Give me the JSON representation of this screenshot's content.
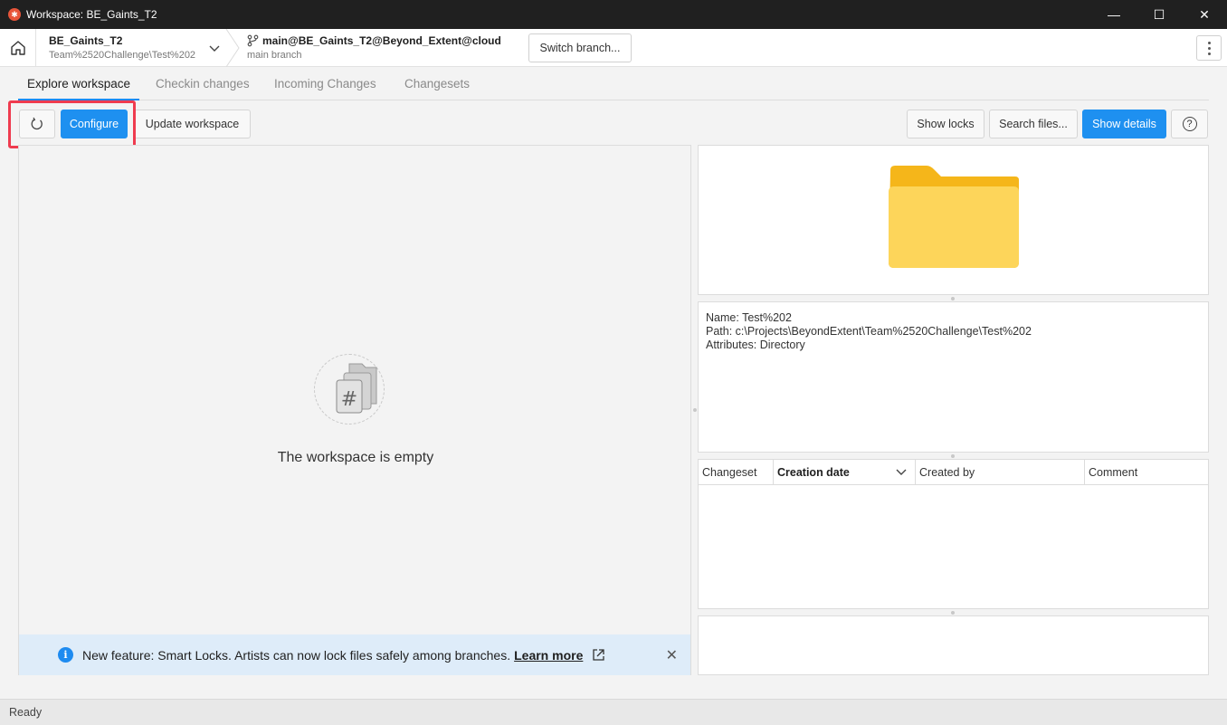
{
  "window": {
    "title": "Workspace: BE_Gaints_T2",
    "minimize_glyph": "—",
    "maximize_glyph": "☐",
    "close_glyph": "✕"
  },
  "header": {
    "workspace_name": "BE_Gaints_T2",
    "workspace_path": "Team%2520Challenge\\Test%202",
    "branch_name": "main@BE_Gaints_T2@Beyond_Extent@cloud",
    "branch_sub": "main branch",
    "switch_branch_label": "Switch branch..."
  },
  "tabs": [
    {
      "label": "Explore workspace",
      "active": true
    },
    {
      "label": "Checkin changes",
      "active": false
    },
    {
      "label": "Incoming Changes",
      "active": false
    },
    {
      "label": "Changesets",
      "active": false
    }
  ],
  "toolbar": {
    "configure_label": "Configure",
    "update_label": "Update workspace",
    "show_locks_label": "Show locks",
    "search_files_label": "Search files...",
    "show_details_label": "Show details",
    "help_glyph": "?"
  },
  "workspace": {
    "empty_message": "The workspace is empty"
  },
  "banner": {
    "message": "New feature: Smart Locks. Artists can now lock files safely among branches.",
    "link_label": "Learn more",
    "close_glyph": "✕"
  },
  "details": {
    "name_line": "Name: Test%202",
    "path_line": "Path: c:\\Projects\\BeyondExtent\\Team%2520Challenge\\Test%202",
    "attributes_line": "Attributes: Directory"
  },
  "history": {
    "columns": [
      "Changeset",
      "Creation date",
      "Created by",
      "Comment"
    ]
  },
  "status": {
    "text": "Ready"
  },
  "colors": {
    "accent": "#1e90f0",
    "highlight": "#ef3b4f",
    "folder": "#f9c43c"
  }
}
